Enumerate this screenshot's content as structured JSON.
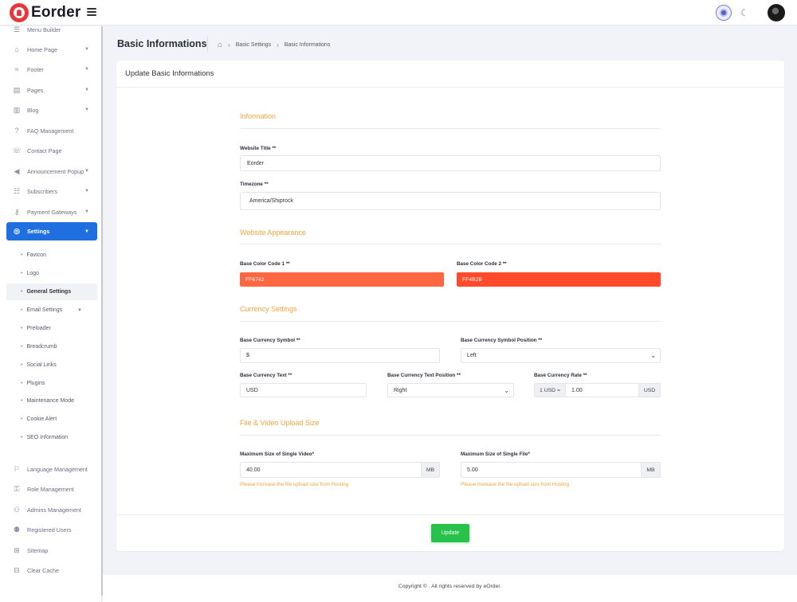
{
  "brand": {
    "name": "Eorder"
  },
  "sidebar": {
    "items": [
      {
        "label": "Menu Builder",
        "icon": "☰",
        "caret": false
      },
      {
        "label": "Home Page",
        "icon": "⌂",
        "caret": true
      },
      {
        "label": "Footer",
        "icon": "≈",
        "caret": true
      },
      {
        "label": "Pages",
        "icon": "▤",
        "caret": true
      },
      {
        "label": "Blog",
        "icon": "▥",
        "caret": true
      },
      {
        "label": "FAQ Management",
        "icon": "?",
        "caret": false
      },
      {
        "label": "Contact Page",
        "icon": "☏",
        "caret": false
      },
      {
        "label": "Announcement Popup",
        "icon": "📢",
        "caret": true
      },
      {
        "label": "Subscribers",
        "icon": "☷",
        "caret": true
      },
      {
        "label": "Payment Gateways",
        "icon": "⚷",
        "caret": true
      },
      {
        "label": "Settings",
        "icon": "◎",
        "caret": true
      },
      {
        "label": "Language Management",
        "icon": "⚐",
        "caret": false
      },
      {
        "label": "Role Management",
        "icon": "⚿",
        "caret": false
      },
      {
        "label": "Admins Management",
        "icon": "👤",
        "caret": false
      },
      {
        "label": "Registered Users",
        "icon": "👥",
        "caret": false
      },
      {
        "label": "Sitemap",
        "icon": "⊞",
        "caret": false
      },
      {
        "label": "Clear Cache",
        "icon": "⊟",
        "caret": false
      }
    ],
    "settings_sub": [
      "Favicon",
      "Logo",
      "General Settings",
      "Email Settings",
      "Preloader",
      "Breadcrumb",
      "Social Links",
      "Plugins",
      "Maintenance Mode",
      "Cookie Alert",
      "SEO Information"
    ]
  },
  "header": {
    "title": "Basic Informations",
    "breadcrumb": [
      "Basic Settings",
      "Basic Informations"
    ]
  },
  "card": {
    "title": "Update Basic Informations",
    "sections": {
      "information": "Information",
      "appearance": "Website Appearance",
      "currency": "Currency Settings",
      "upload": "File & Video Upload Size"
    },
    "fields": {
      "website_title": {
        "label": "Website Title **",
        "value": "Eorder"
      },
      "timezone": {
        "label": "Timezone **",
        "value": "America/Shiprock"
      },
      "color1": {
        "label": "Base Color Code 1 **",
        "value": "FF6742",
        "color": "#ff6742"
      },
      "color2": {
        "label": "Base Color Code 2 **",
        "value": "FF4B2B",
        "color": "#ff4b2b"
      },
      "currency_symbol": {
        "label": "Base Currency Symbol **",
        "value": "$"
      },
      "currency_symbol_position": {
        "label": "Base Currency Symbol Position **",
        "value": "Left"
      },
      "currency_text": {
        "label": "Base Currency Text **",
        "value": "USD"
      },
      "currency_text_position": {
        "label": "Base Currency Text Position **",
        "value": "Right"
      },
      "currency_rate": {
        "label": "Base Currency Rate **",
        "prefix": "1 USD =",
        "value": "1.00",
        "suffix": "USD"
      },
      "max_video": {
        "label": "Maximum Size of Single Video*",
        "value": "40.00",
        "unit": "MB",
        "hint": "Please increase the file upload size from Hosting"
      },
      "max_file": {
        "label": "Maximum Size of Single File*",
        "value": "5.00",
        "unit": "MB",
        "hint": "Please increase the file upload size from Hosting"
      }
    },
    "update_label": "Update"
  },
  "footer": {
    "copyright": "Copyright © . All rights reserved by eOrder."
  },
  "colors": {
    "accent": "#1f6fe0",
    "section": "#f4a43a",
    "update": "#28c24a"
  }
}
